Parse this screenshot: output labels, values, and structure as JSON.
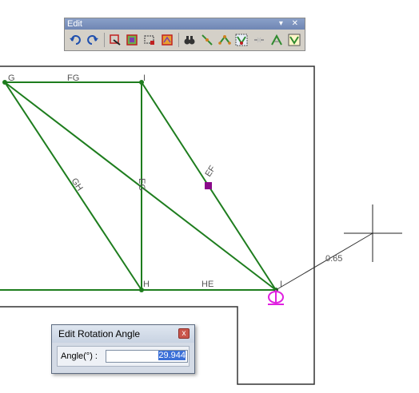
{
  "toolbar": {
    "title": "Edit",
    "title_controls": "▾ ✕",
    "buttons": [
      {
        "name": "undo-icon",
        "glyph": "undo"
      },
      {
        "name": "redo-icon",
        "glyph": "redo"
      },
      {
        "name": "sep"
      },
      {
        "name": "select-sketch-icon",
        "glyph": "sketch"
      },
      {
        "name": "multi-select-icon",
        "glyph": "multi"
      },
      {
        "name": "rectangle-select-icon",
        "glyph": "rect"
      },
      {
        "name": "reshape-icon",
        "glyph": "reshape"
      },
      {
        "name": "sep"
      },
      {
        "name": "find-icon",
        "glyph": "binoculars"
      },
      {
        "name": "split-line-icon",
        "glyph": "split"
      },
      {
        "name": "move-vertex-icon",
        "glyph": "vertex"
      },
      {
        "name": "rotate-icon",
        "glyph": "rotate"
      },
      {
        "name": "join-icon",
        "glyph": "join"
      },
      {
        "name": "trim-icon",
        "glyph": "trim"
      },
      {
        "name": "extend-icon",
        "glyph": "extend"
      }
    ]
  },
  "drawing": {
    "labels": {
      "G": "G",
      "FG": "FG",
      "I": "I",
      "GH": "GH",
      "EG": "EG",
      "EF": "EF",
      "H": "H",
      "HE": "HE",
      "E": "I",
      "distance": "0.65"
    },
    "colors": {
      "line": "#1e7d1e",
      "boundary": "#333333",
      "handle": "#8a0a8a",
      "magenta": "#e020e0"
    }
  },
  "dialog": {
    "title": "Edit Rotation Angle",
    "close": "x",
    "label": "Angle(°) :",
    "value": "29.944"
  }
}
